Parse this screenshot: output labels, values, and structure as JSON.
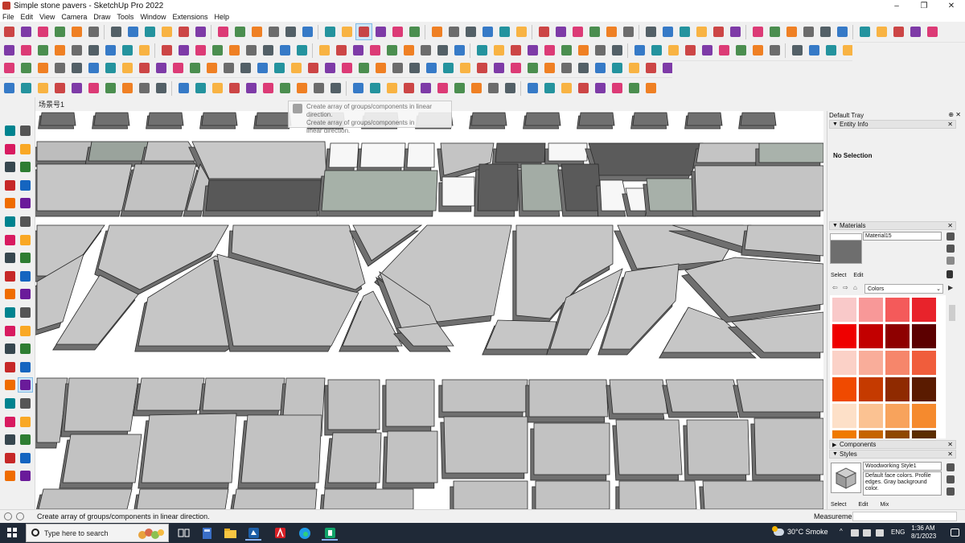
{
  "window": {
    "title": "Simple stone pavers - SketchUp Pro 2022",
    "controls": [
      "–",
      "❐",
      "✕"
    ]
  },
  "menu": [
    "File",
    "Edit",
    "View",
    "Camera",
    "Draw",
    "Tools",
    "Window",
    "Extensions",
    "Help"
  ],
  "scene_tab": "场景号1",
  "tooltip": {
    "line1": "Create array of groups/components in linear direction.",
    "line2": "Create array of groups/components in",
    "line3": "linear direction."
  },
  "tray": {
    "title": "Default Tray",
    "pin": "⊕ ✕",
    "entity_info": {
      "header": "Entity Info",
      "selection": "No Selection"
    },
    "materials": {
      "header": "Materials",
      "current_name": "Material15",
      "tabs": [
        "Select",
        "Edit"
      ],
      "library": "Colors",
      "swatches": [
        "#f9c9c9",
        "#f89898",
        "#f45a5a",
        "#e8232b",
        "#ef0000",
        "#c20000",
        "#8e0000",
        "#5c0000",
        "#fbd1c7",
        "#f9ad9a",
        "#f6866b",
        "#f05d3c",
        "#f04a00",
        "#c53a00",
        "#8f2a00",
        "#5a1b00",
        "#fde0c8",
        "#fbc292",
        "#f8a35c",
        "#f58a2e",
        "#ef7a00",
        "#c56400",
        "#8f4800",
        "#5b2d00"
      ]
    },
    "components": {
      "header": "Components"
    },
    "styles": {
      "header": "Styles",
      "name": "Woodworking Style1",
      "description": "Default face colors. Profile edges. Gray background color.",
      "tabs": [
        "Select",
        "Edit",
        "Mix"
      ]
    }
  },
  "status": {
    "text": "Create array of groups/components in linear direction.",
    "measurements_label": "Measurements"
  },
  "taskbar": {
    "search_placeholder": "Type here to search",
    "weather": "30°C  Smoke",
    "language": "ENG",
    "time": "1:36 AM",
    "date": "8/1/2023"
  },
  "icons": {
    "toolbar": [
      "select-icon",
      "eraser-icon",
      "pencil-icon",
      "arc-icon",
      "paint-bucket-icon",
      "push-pull-icon",
      "move-icon",
      "rotate-icon",
      "scale-icon",
      "tape-measure-icon",
      "text-icon",
      "axes-icon",
      "orbit-icon",
      "pan-icon",
      "zoom-icon",
      "zoom-extents-icon",
      "warehouse-icon",
      "extension-icon",
      "user-icon"
    ]
  },
  "colors": {
    "accent": "#1a73e8",
    "paver_light": "#c8c8c8",
    "paver_dark": "#595959",
    "paver_side": "#7a7a7a",
    "taskbar_bg": "#1f2937"
  }
}
